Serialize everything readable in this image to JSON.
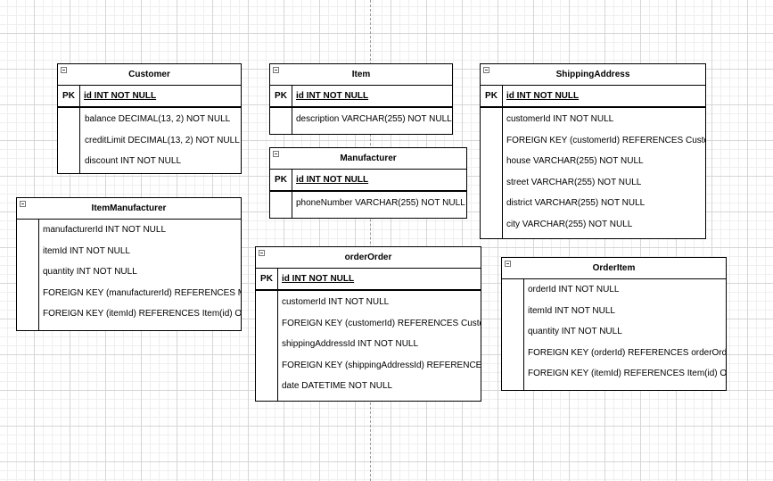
{
  "diagram": {
    "tables": {
      "customer": {
        "name": "Customer",
        "pk_label": "PK",
        "pk": "id INT NOT NULL",
        "attributes": [
          "balance DECIMAL(13, 2) NOT NULL",
          "creditLimit DECIMAL(13, 2) NOT NULL",
          "discount INT NOT NULL"
        ]
      },
      "item": {
        "name": "Item",
        "pk_label": "PK",
        "pk": "id INT NOT NULL",
        "attributes": [
          "description VARCHAR(255) NOT NULL"
        ]
      },
      "shipping_address": {
        "name": "ShippingAddress",
        "pk_label": "PK",
        "pk": "id INT NOT NULL",
        "attributes": [
          "customerId INT NOT NULL",
          "FOREIGN KEY (customerId) REFERENCES Custom",
          "house VARCHAR(255) NOT NULL",
          "street VARCHAR(255) NOT NULL",
          "district VARCHAR(255) NOT NULL",
          "city VARCHAR(255) NOT NULL"
        ]
      },
      "manufacturer": {
        "name": "Manufacturer",
        "pk_label": "PK",
        "pk": "id INT NOT NULL",
        "attributes": [
          "phoneNumber VARCHAR(255) NOT NULL"
        ]
      },
      "item_manufacturer": {
        "name": "ItemManufacturer",
        "attributes": [
          "manufacturerId INT NOT NULL",
          "itemId INT NOT NULL",
          "quantity INT NOT NULL",
          "FOREIGN KEY (manufacturerId) REFERENCES Mar",
          "FOREIGN KEY (itemId) REFERENCES Item(id) ON I"
        ]
      },
      "order_order": {
        "name": "orderOrder",
        "pk_label": "PK",
        "pk": "id INT NOT NULL",
        "attributes": [
          "customerId INT NOT NULL",
          "FOREIGN KEY (customerId) REFERENCES Custom",
          "shippingAddressId INT NOT NULL",
          "FOREIGN KEY (shippingAddressId) REFERENCES S",
          "date DATETIME NOT NULL"
        ]
      },
      "order_item": {
        "name": "OrderItem",
        "attributes": [
          "orderId INT NOT NULL",
          "itemId INT NOT NULL",
          "quantity INT NOT NULL",
          "FOREIGN KEY (orderId) REFERENCES orderOrder(",
          "FOREIGN KEY (itemId) REFERENCES Item(id) ON I"
        ]
      }
    }
  }
}
